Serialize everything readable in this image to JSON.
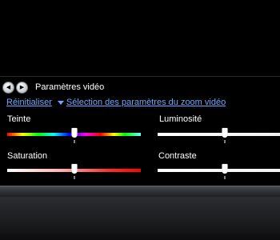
{
  "panel": {
    "title": "Paramètres vidéo",
    "back_icon": "chevron-left-icon",
    "forward_icon": "chevron-right-icon",
    "reset_link": "Réinitialiser",
    "zoom_link": "Sélection des paramètres du zoom vidéo"
  },
  "sliders": {
    "hue": {
      "label": "Teinte",
      "value": 0.5
    },
    "brightness": {
      "label": "Luminosité",
      "value": 0.5
    },
    "saturation": {
      "label": "Saturation",
      "value": 0.5
    },
    "contrast": {
      "label": "Contraste",
      "value": 0.5
    }
  }
}
